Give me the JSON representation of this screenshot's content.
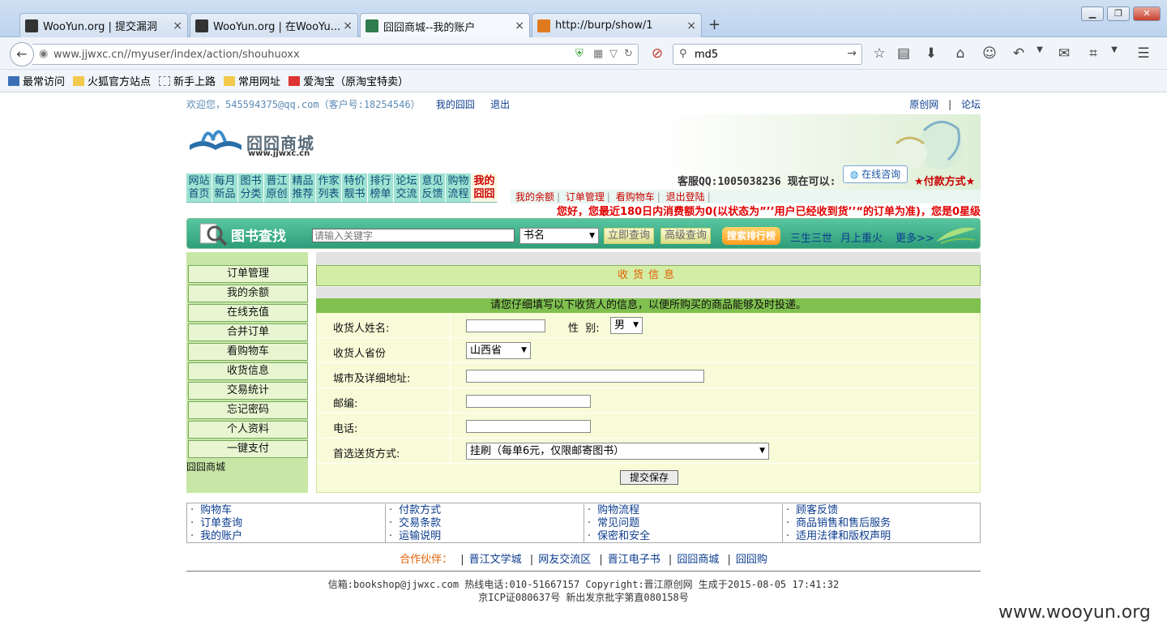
{
  "tabs": [
    {
      "title": "WooYun.org | 提交漏洞"
    },
    {
      "title": "WooYun.org | 在WooYu..."
    },
    {
      "title": "囧囧商城--我的账户"
    },
    {
      "title": "http://burp/show/1"
    }
  ],
  "tab_close": "×",
  "new_tab": "+",
  "window_controls": {
    "minimize": "▁",
    "maximize": "❐",
    "close": "✕"
  },
  "address": {
    "url": "www.jjwxc.cn//myuser/index/action/shouhuoxx"
  },
  "search": {
    "value": "md5"
  },
  "bookmarks": [
    "最常访问",
    "火狐官方站点",
    "新手上路",
    "常用网址",
    "爱淘宝（原淘宝特卖）"
  ],
  "welcome": {
    "greeting": "欢迎您，545594375@qq.com（客户号:18254546）",
    "my_account": "我的囧囧",
    "logout": "退出",
    "yuanchuang": "原创网",
    "sep": "|",
    "forum": "论坛"
  },
  "logo": {
    "name": "囧囧商城",
    "url": "www.jjwxc.cn"
  },
  "nav": [
    {
      "l1": "网站",
      "l2": "首页"
    },
    {
      "l1": "每月",
      "l2": "新品"
    },
    {
      "l1": "图书",
      "l2": "分类"
    },
    {
      "l1": "晋江",
      "l2": "原创"
    },
    {
      "l1": "精品",
      "l2": "推荐"
    },
    {
      "l1": "作家",
      "l2": "列表"
    },
    {
      "l1": "特价",
      "l2": "靓书"
    },
    {
      "l1": "排行",
      "l2": "榜单"
    },
    {
      "l1": "论坛",
      "l2": "交流"
    },
    {
      "l1": "意见",
      "l2": "反馈"
    },
    {
      "l1": "购物",
      "l2": "流程"
    },
    {
      "l1": "我的",
      "l2": "囧囧"
    }
  ],
  "kefu": {
    "qq": "客服QQ:1005038236  现在可以:",
    "online": "在线咨询",
    "pay": "★付款方式★"
  },
  "sublinks": [
    "我的余额",
    "订单管理",
    "看购物车",
    "退出登陆"
  ],
  "notice": "您好，您最近180日内消费额为0(以状态为”’’用户已经收到货’’“的订单为准)，您是0星级",
  "book_search": {
    "title": "图书查找",
    "placeholder": "请输入关键字",
    "type": "书名",
    "search_now": "立即查询",
    "advanced": "高级查询",
    "rank": "搜索排行榜",
    "links": [
      "三生三世",
      "月上重火",
      "更多>>"
    ]
  },
  "sidebar": {
    "items": [
      "订单管理",
      "我的余额",
      "在线充值",
      "合并订单",
      "看购物车",
      "收货信息",
      "交易统计",
      "忘记密码",
      "个人资料",
      "一键支付"
    ],
    "footer": "囧囧商城"
  },
  "main": {
    "title": "收货信息",
    "subtitle": "请您仔细填写以下收货人的信息，以便所购买的商品能够及时投递。",
    "fields": {
      "name_label": "收货人姓名:",
      "gender_label": "性  别:",
      "gender_value": "男",
      "province_label": "收货人省份",
      "province_value": "山西省",
      "address_label": "城市及详细地址:",
      "zip_label": "邮编:",
      "phone_label": "电话:",
      "ship_label": "首选送货方式:",
      "ship_value": "挂刷（每单6元，仅限邮寄图书）"
    },
    "submit": "提交保存"
  },
  "footer_links": [
    [
      "购物车",
      "订单查询",
      "我的账户"
    ],
    [
      "付款方式",
      "交易条款",
      "运输说明"
    ],
    [
      "购物流程",
      "常见问题",
      "保密和安全"
    ],
    [
      "顾客反馈",
      "商品销售和售后服务",
      "适用法律和版权声明"
    ]
  ],
  "partners": {
    "label": "合作伙伴：",
    "items": [
      "晋江文学城",
      "网友交流区",
      "晋江电子书",
      "囧囧商城",
      "囧囧购"
    ]
  },
  "footer": {
    "line1": "信箱:bookshop@jjwxc.com 热线电话:010-51667157 Copyright:晋江原创网 生成于2015-08-05 17:41:32",
    "line2": "京ICP证080637号   新出发京批字第直080158号"
  },
  "watermark": "www.wooyun.org",
  "colors": {
    "accent_green": "#7fc04e",
    "nav_teal": "#9ee2d2",
    "alert_red": "#e00000",
    "link_blue": "#0d3d8f"
  }
}
